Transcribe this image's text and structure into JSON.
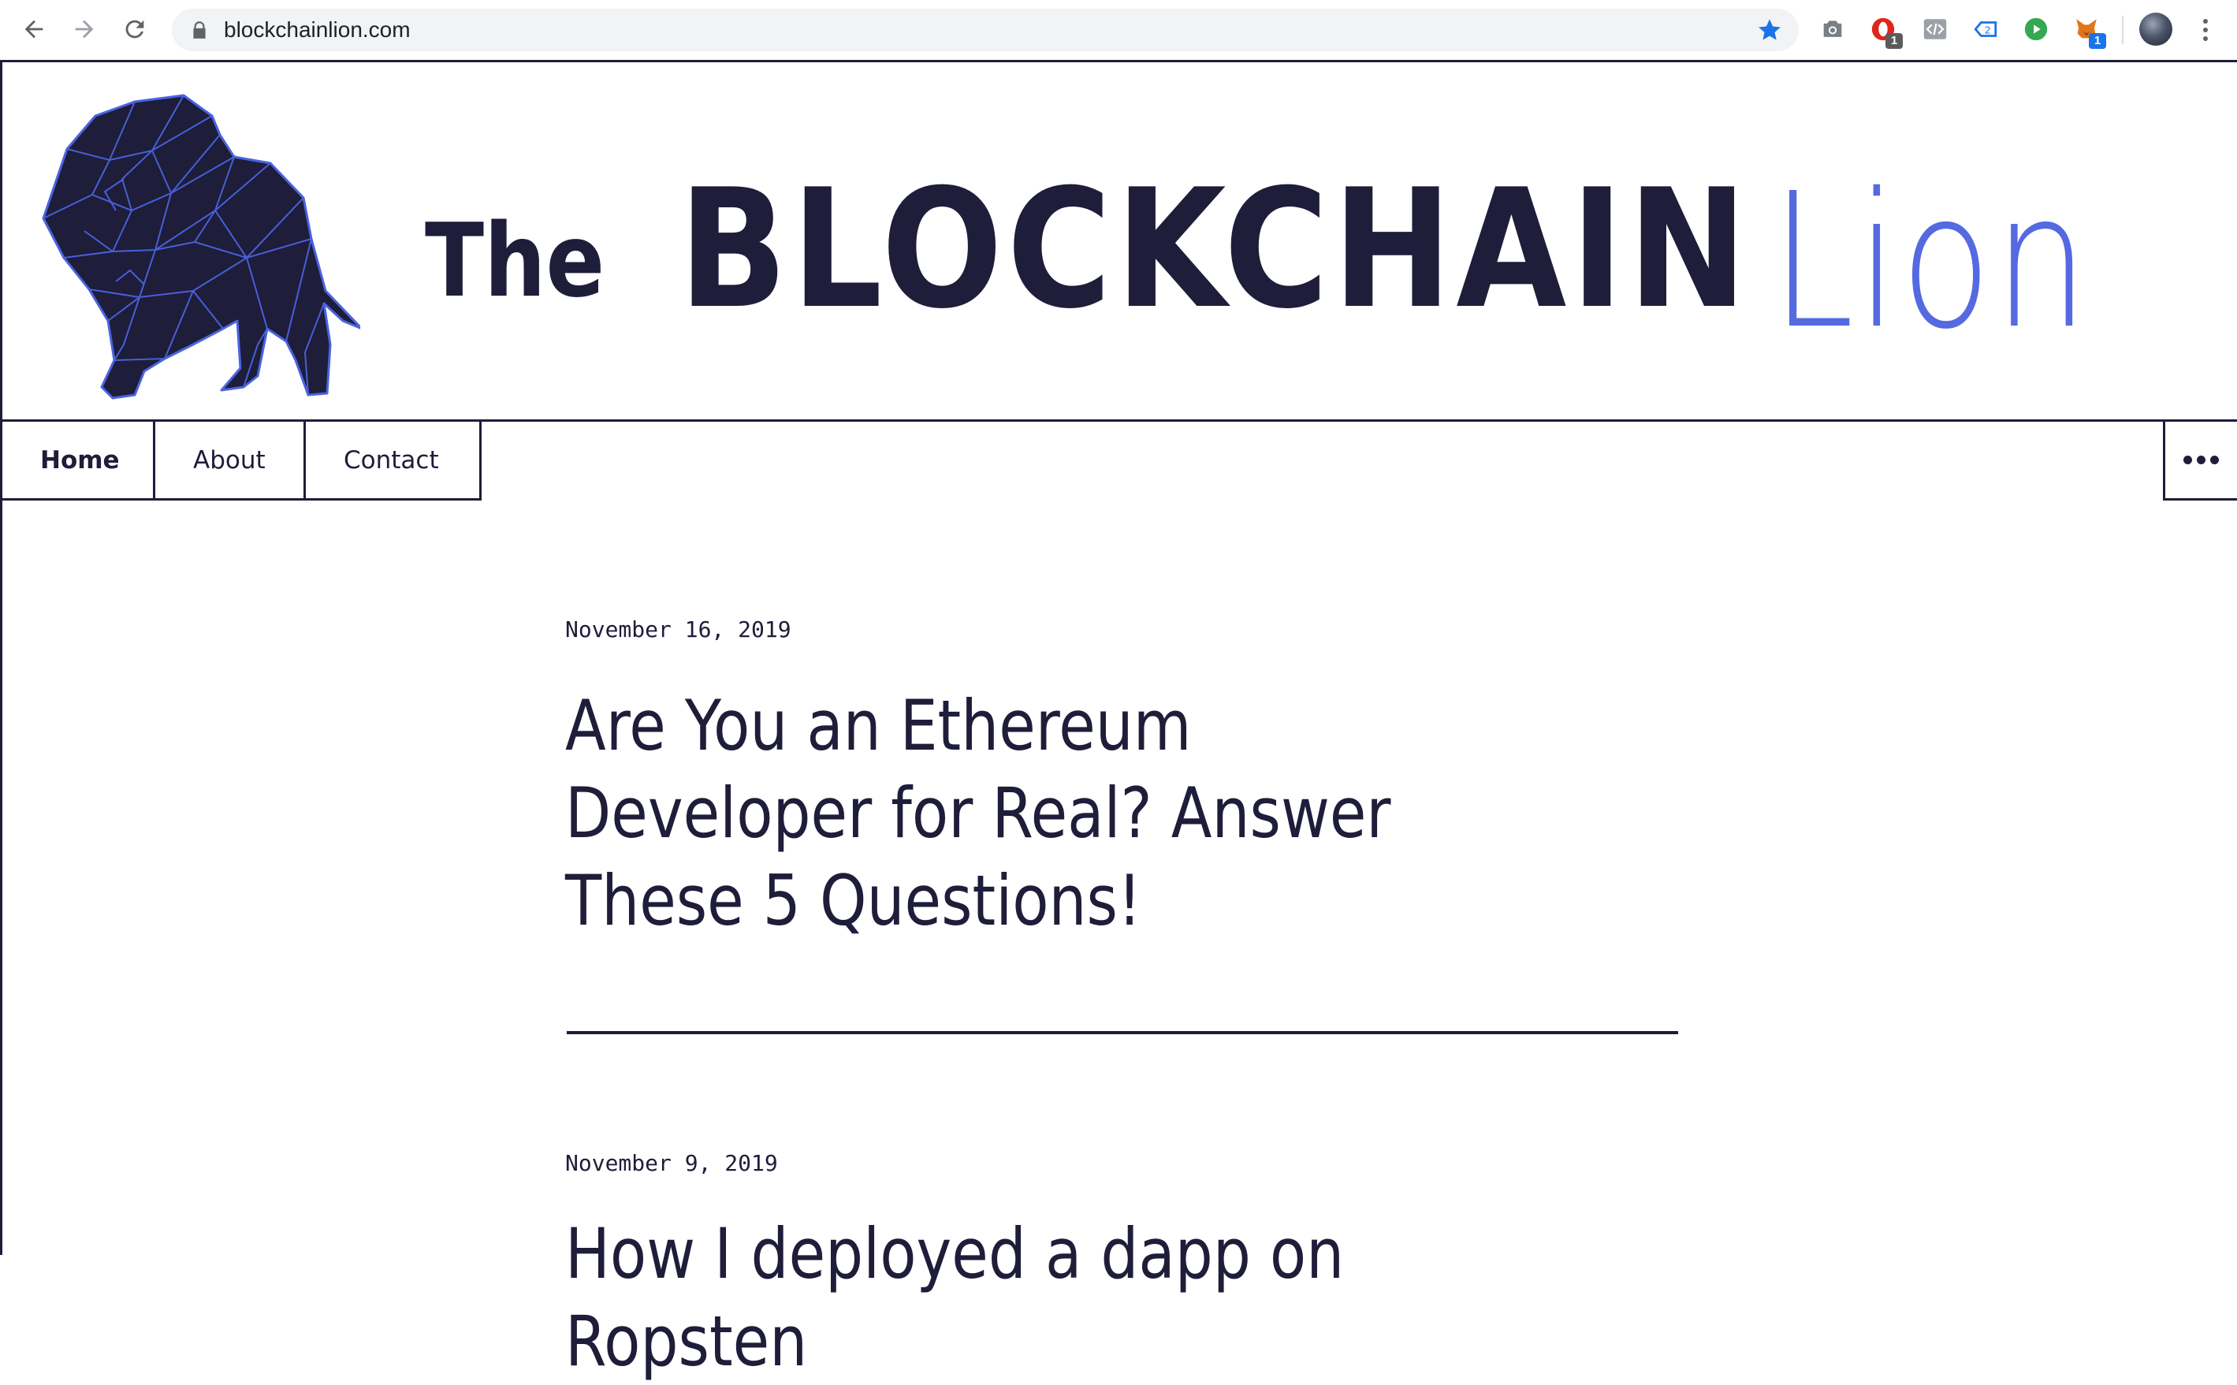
{
  "browser": {
    "url": "blockchainlion.com",
    "extension_badges": [
      "1",
      "1"
    ]
  },
  "site": {
    "title_the": "The",
    "title_blockchain": "BLOCKCHAIN",
    "title_lion": "Lion",
    "colors": {
      "navy": "#1e1d3a",
      "accent_blue": "#5569e1"
    }
  },
  "menu": {
    "items": [
      {
        "label": "Home",
        "active": true
      },
      {
        "label": "About",
        "active": false
      },
      {
        "label": "Contact",
        "active": false
      }
    ],
    "more_icon": "ellipsis-icon"
  },
  "posts": [
    {
      "date": "November 16, 2019",
      "title": "Are You an Ethereum Developer for Real? Answer These 5 Questions!"
    },
    {
      "date": "November 9, 2019",
      "title": "How I deployed a dapp on Ropsten"
    }
  ]
}
